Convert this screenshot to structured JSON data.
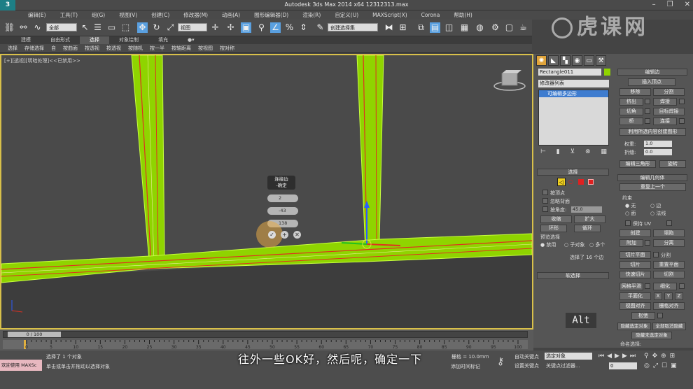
{
  "app": {
    "title": "Autodesk 3ds Max  2014 x64      12312313.max",
    "window_buttons": [
      "–",
      "❐",
      "✕"
    ]
  },
  "menu": [
    "编辑(E)",
    "工具(T)",
    "组(G)",
    "视图(V)",
    "创建(C)",
    "修改器(M)",
    "动画(A)",
    "图形编辑器(D)",
    "渲染(R)",
    "自定义(U)",
    "MAXScript(X)",
    "Corona",
    "帮助(H)"
  ],
  "toolbar": {
    "selection_filter": "全部",
    "ref_coord": "视图",
    "named_selection": "创建选择集"
  },
  "ribbon_tabs": [
    "建模",
    "自由形式",
    "选择",
    "对象绘制",
    "填充"
  ],
  "ribbon_active": "选择",
  "ribbon_items": [
    "选择",
    "存储选择",
    "自",
    "按曲面",
    "按透视",
    "按透视",
    "按随机",
    "按一半",
    "按轴距离",
    "按视图",
    "按对称"
  ],
  "viewport": {
    "label": "[+][透视][明暗处理]<<已禁用>>"
  },
  "caddy": {
    "title_line1": "连接边",
    "title_line2": "-确定",
    "segments": "2",
    "pinch": "-43",
    "slide": "138"
  },
  "command_panel": {
    "object_name": "Rectangle011",
    "modifier_list": "修改器列表",
    "modifier_item": "可编辑多边形",
    "selection_rollout": "选择",
    "by_vertex": "按顶点",
    "ignore_backfacing": "忽略背面",
    "by_angle": "按角度:",
    "angle_value": "45.0",
    "shrink": "收缩",
    "grow": "扩大",
    "ring": "环形",
    "loop": "循环",
    "preview_selection": "预览选择",
    "preview_options": [
      "禁用",
      "子对象",
      "多个"
    ],
    "selected_count": "选择了 16 个边",
    "soft_selection": "软选择",
    "edit_edges": "编辑边",
    "insert_vertex": "插入顶点",
    "remove": "移除",
    "split": "分割",
    "extrude": "挤出",
    "weld": "焊接",
    "chamfer": "切角",
    "target_weld": "目标焊接",
    "bridge": "桥",
    "connect": "连接",
    "create_shape": "利用所选内容创建图形",
    "weight_label": "权重:",
    "weight": "1.0",
    "crease_label": "折缝:",
    "crease": "0.0",
    "edit_tri": "编辑三角形",
    "turn": "旋转",
    "edit_geometry": "编辑几何体",
    "repeat_last": "重复上一个",
    "constraints": "约束",
    "constraint_opts": [
      "无",
      "边",
      "面",
      "法线"
    ],
    "preserve_uv": "保持 UV",
    "create": "创建",
    "collapse": "塌陷",
    "attach": "附加",
    "detach": "分离",
    "slice_plane": "切片平面",
    "split2": "分割",
    "slice": "切片",
    "reset_plane": "重置平面",
    "quickslice": "快速切片",
    "cut": "切割",
    "meshsmooth": "网格平滑",
    "tessellate": "细化",
    "planarize": "平面化",
    "xyz": [
      "X",
      "Y",
      "Z"
    ],
    "view_align": "视图对齐",
    "grid_align": "栅格对齐",
    "relax": "松弛",
    "hide_selected": "隐藏选定对象",
    "unhide_all": "全部取消隐藏",
    "hide_unselected": "隐藏未选定对象",
    "named_sel": "命名选择:"
  },
  "timeline": {
    "frame": "0 / 100",
    "ticks": [
      "0",
      "5",
      "10",
      "15",
      "20",
      "25",
      "30",
      "35",
      "40",
      "45",
      "50",
      "55",
      "60",
      "65",
      "70",
      "75",
      "80",
      "85",
      "90",
      "95",
      "100"
    ]
  },
  "status": {
    "welcome": "欢迎使用 MAXSc",
    "line1": "选择了 1 个对象",
    "line2": "单击或单击并拖动以选择对象",
    "grid": "栅格 = 10.0mm",
    "autokey": "自动关键点",
    "setkey": "设置关键点",
    "selected_obj": "选定对象",
    "key_filter": "关键点过滤器...",
    "add_time_tag": "添加时间标记",
    "frame_value": "0"
  },
  "caption": "往外一些OK好，然后呢，确定一下",
  "key_overlay": "Alt",
  "watermark": "虎课网",
  "colors": {
    "accent": "#d8c04a",
    "frame_green": "#8fd400",
    "edge_red": "#e03020",
    "caption": "#ffffff"
  }
}
